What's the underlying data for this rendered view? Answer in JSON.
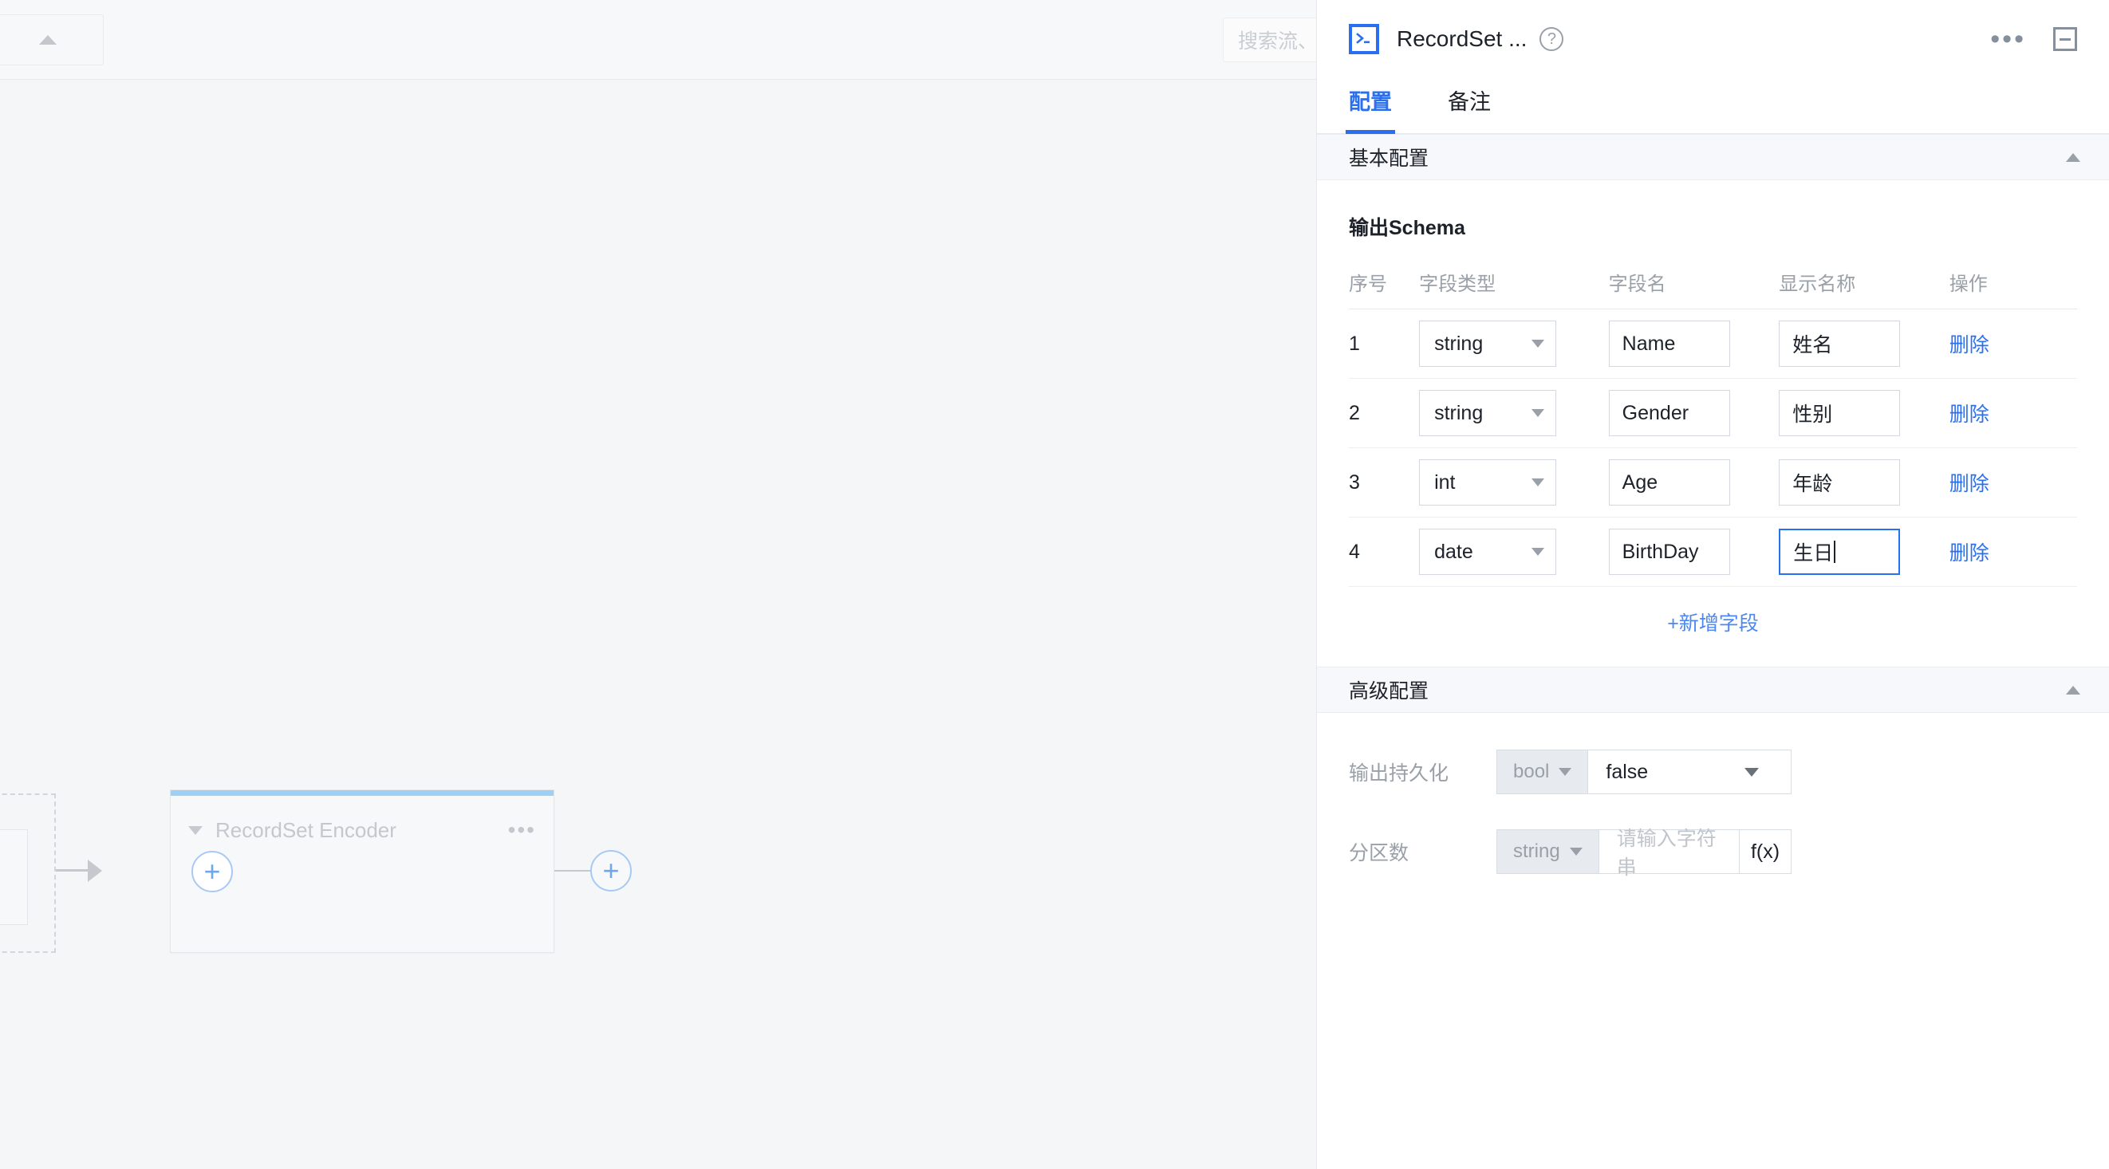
{
  "canvas": {
    "toolbar": {
      "collapse_icon": "triangle-up-icon"
    },
    "search": {
      "placeholder": "搜索流、"
    },
    "node": {
      "title": "RecordSet Encoder",
      "collapse_icon": "caret-down-icon",
      "menu_icon": "more-dots-icon",
      "add_inner_label": "+",
      "add_outer_label": "+"
    }
  },
  "panel": {
    "icon": "terminal-icon",
    "title": "RecordSet ...",
    "help_icon": "help-circle-icon",
    "more_icon": "more-dots-icon",
    "minimize_icon": "minimize-icon",
    "tabs": [
      {
        "label": "配置",
        "active": true
      },
      {
        "label": "备注",
        "active": false
      }
    ],
    "basic_section": {
      "title": "基本配置",
      "collapse_icon": "caret-up-icon",
      "schema": {
        "title": "输出Schema",
        "columns": [
          "序号",
          "字段类型",
          "字段名",
          "显示名称",
          "操作"
        ],
        "rows": [
          {
            "index": "1",
            "type": "string",
            "field": "Name",
            "display": "姓名",
            "action": "删除",
            "focused": false
          },
          {
            "index": "2",
            "type": "string",
            "field": "Gender",
            "display": "性别",
            "action": "删除",
            "focused": false
          },
          {
            "index": "3",
            "type": "int",
            "field": "Age",
            "display": "年龄",
            "action": "删除",
            "focused": false
          },
          {
            "index": "4",
            "type": "date",
            "field": "BirthDay",
            "display": "生日",
            "action": "删除",
            "focused": true
          }
        ],
        "add_label": "+新增字段"
      }
    },
    "advanced_section": {
      "title": "高级配置",
      "collapse_icon": "caret-up-icon",
      "fields": [
        {
          "label": "输出持久化",
          "type": "bool",
          "value": "false",
          "placeholder": "",
          "has_fx": false
        },
        {
          "label": "分区数",
          "type": "string",
          "value": "",
          "placeholder": "请输入字符串",
          "has_fx": true,
          "fx_label": "f(x)"
        }
      ]
    }
  },
  "colors": {
    "accent": "#2a6ff0",
    "link": "#4a87f7",
    "node_accent": "#9ed0f5",
    "canvas_bg": "#f5f6f8"
  }
}
